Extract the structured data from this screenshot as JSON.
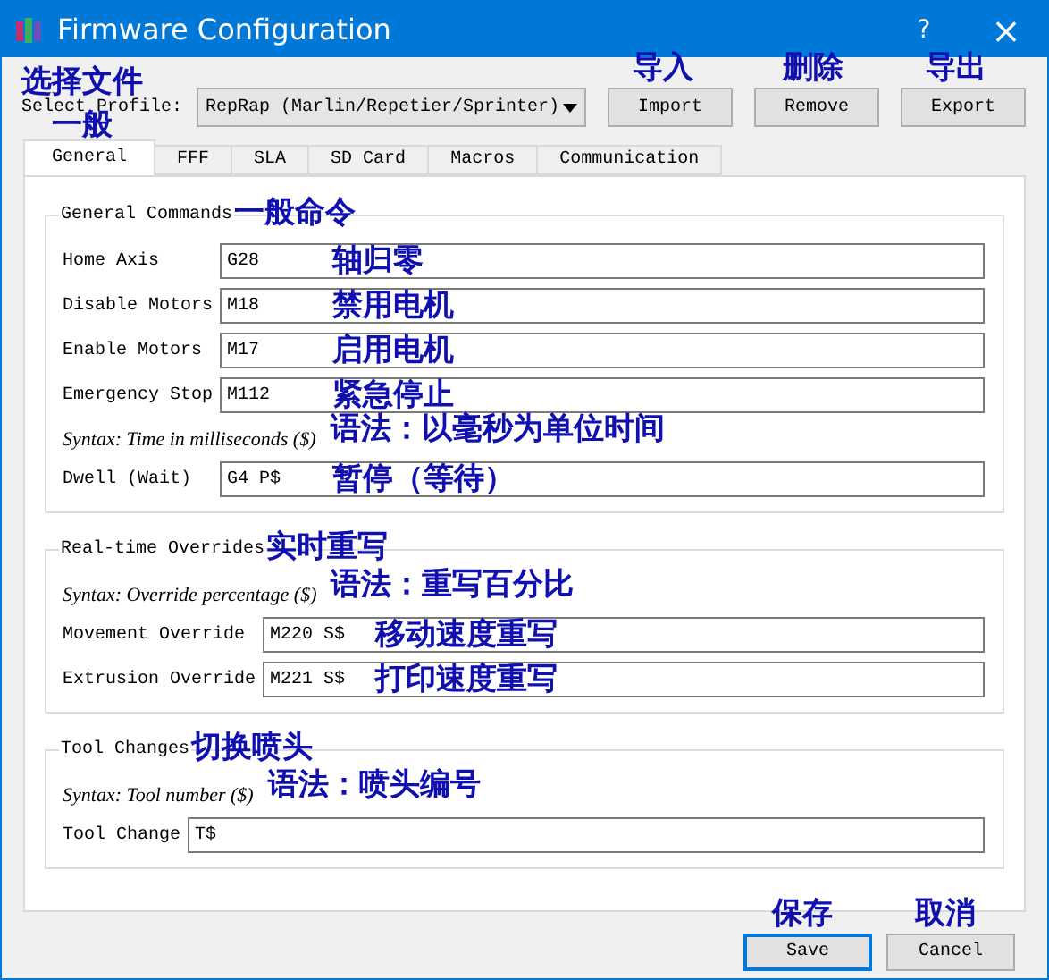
{
  "window": {
    "title": "Firmware Configuration",
    "help": "?",
    "close": "×"
  },
  "profile": {
    "label": "Select Profile:",
    "note": "选择文件",
    "value": "RepRap (Marlin/Repetier/Sprinter)"
  },
  "profile_buttons": [
    {
      "label": "Import",
      "note": "导入"
    },
    {
      "label": "Remove",
      "note": "删除"
    },
    {
      "label": "Export",
      "note": "导出"
    }
  ],
  "tabs": [
    {
      "label": "General",
      "selected": true,
      "note": "一般"
    },
    {
      "label": "FFF",
      "selected": false
    },
    {
      "label": "SLA",
      "selected": false
    },
    {
      "label": "SD Card",
      "selected": false
    },
    {
      "label": "Macros",
      "selected": false
    },
    {
      "label": "Communication",
      "selected": false
    }
  ],
  "groups": [
    {
      "title": "General Commands",
      "note": "一般命令",
      "rows": [
        {
          "kind": "field",
          "label": "Home Axis",
          "value": "G28",
          "note": "轴归零"
        },
        {
          "kind": "field",
          "label": "Disable Motors",
          "value": "M18",
          "note": "禁用电机"
        },
        {
          "kind": "field",
          "label": "Enable Motors",
          "value": "M17",
          "note": "启用电机"
        },
        {
          "kind": "field",
          "label": "Emergency Stop",
          "value": "M112",
          "note": "紧急停止"
        },
        {
          "kind": "syntax",
          "text": "Syntax: Time in milliseconds ($)",
          "note": "语法：以毫秒为单位时间"
        },
        {
          "kind": "field",
          "label": "Dwell (Wait)",
          "value": "G4 P$",
          "note": "暂停（等待）"
        }
      ]
    },
    {
      "title": "Real-time Overrides",
      "note": "实时重写",
      "rows": [
        {
          "kind": "syntax",
          "text": "Syntax: Override percentage ($)",
          "note": "语法：重写百分比"
        },
        {
          "kind": "field",
          "label": "Movement Override",
          "value": "M220 S$",
          "note": "移动速度重写"
        },
        {
          "kind": "field",
          "label": "Extrusion Override",
          "value": "M221 S$",
          "note": "打印速度重写"
        }
      ]
    },
    {
      "title": "Tool Changes",
      "note": "切换喷头",
      "rows": [
        {
          "kind": "syntax",
          "text": "Syntax: Tool number ($)",
          "note": "语法：喷头编号"
        },
        {
          "kind": "field",
          "label": "Tool Change",
          "value": "T$"
        }
      ]
    }
  ],
  "buttons": [
    {
      "label": "Save",
      "note": "保存",
      "default": true
    },
    {
      "label": "Cancel",
      "note": "取消",
      "default": false
    }
  ]
}
